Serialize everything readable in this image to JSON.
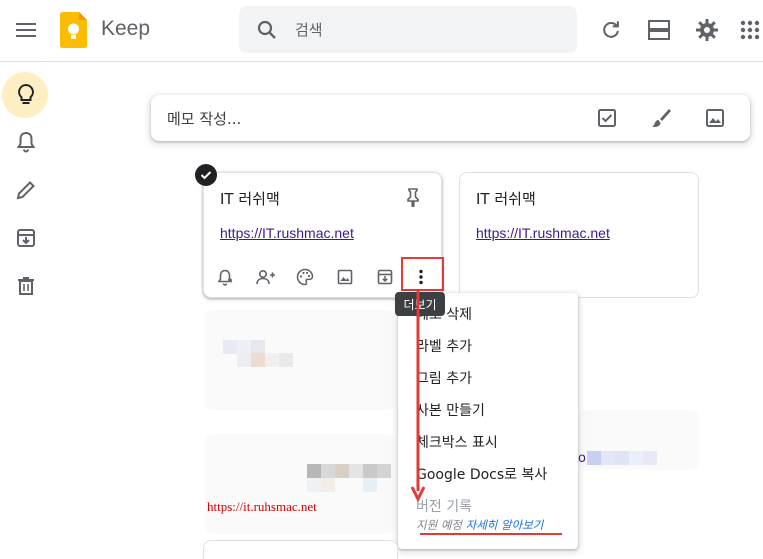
{
  "header": {
    "app_title": "Keep",
    "search_placeholder": "검색"
  },
  "take_note": {
    "placeholder": "메모 작성..."
  },
  "notes": [
    {
      "title": "IT 러쉬맥",
      "link": "https://IT.rushmac.net",
      "pinned_control": true,
      "selected": true
    },
    {
      "title": "IT 러쉬맥",
      "link": "https://IT.rushmac.net"
    }
  ],
  "tooltip": "더보기",
  "menu": {
    "items": [
      {
        "label": "메모 삭제",
        "disabled": false
      },
      {
        "label": "라벨 추가",
        "disabled": false
      },
      {
        "label": "그림 추가",
        "disabled": false
      },
      {
        "label": "사본 만들기",
        "disabled": false
      },
      {
        "label": "체크박스 표시",
        "disabled": false
      },
      {
        "label": "Google Docs로 복사",
        "disabled": false
      },
      {
        "label": "버전 기록",
        "disabled": true
      }
    ],
    "sub_note": "지원 예정",
    "learn_more": "자세히 알아보기"
  },
  "watermark": "https://it.ruhsmac.net",
  "partial_link": "o",
  "colors": {
    "accent_red": "#e53935",
    "active_nav_bg": "#feefc3",
    "logo_yellow": "#fbbc04"
  },
  "icons": {
    "nav": [
      "lightbulb-icon",
      "bell-icon",
      "pencil-icon",
      "archive-icon",
      "trash-icon"
    ],
    "header_right": [
      "refresh-icon",
      "list-view-icon",
      "settings-icon",
      "apps-grid-icon"
    ],
    "take_note_tools": [
      "checkbox-icon",
      "brush-icon",
      "image-icon"
    ],
    "card_tools": [
      "reminder-icon",
      "collaborator-icon",
      "palette-icon",
      "image-icon",
      "archive-icon",
      "more-vert-icon"
    ]
  }
}
